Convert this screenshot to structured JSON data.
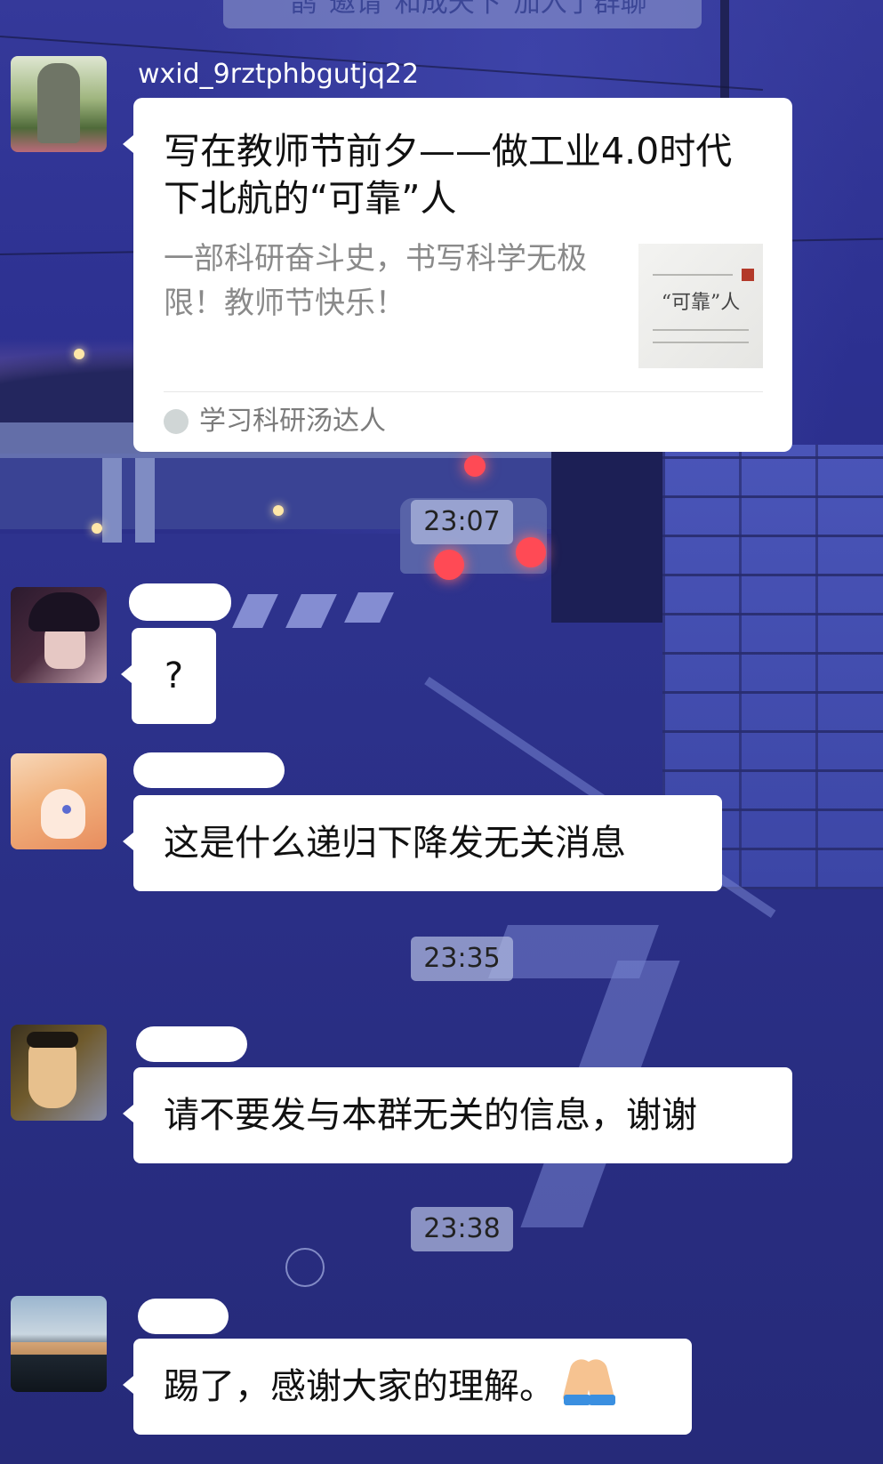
{
  "system_notice": "\"鹊\"邀请\"和成天下\"加入了群聊",
  "messages": [
    {
      "type": "card",
      "sender": "wxid_9rztphbgutjq22",
      "card": {
        "title": "写在教师节前夕——做工业4.0时代下北航的“可靠”人",
        "description": "一部科研奋斗史，书写科学无极限！教师节快乐！",
        "thumbnail_title": "“可靠”人",
        "source": "学习科研汤达人"
      }
    },
    {
      "type": "time",
      "text": "23:07"
    },
    {
      "type": "text",
      "sender": "",
      "text": "?"
    },
    {
      "type": "text",
      "sender": "",
      "text": "这是什么递归下降发无关消息"
    },
    {
      "type": "time",
      "text": "23:35"
    },
    {
      "type": "text",
      "sender": "",
      "text": "请不要发与本群无关的信息，谢谢"
    },
    {
      "type": "time",
      "text": "23:38"
    },
    {
      "type": "text",
      "sender": "",
      "text": "踢了，感谢大家的理解。",
      "emoji": "folded-hands"
    }
  ]
}
